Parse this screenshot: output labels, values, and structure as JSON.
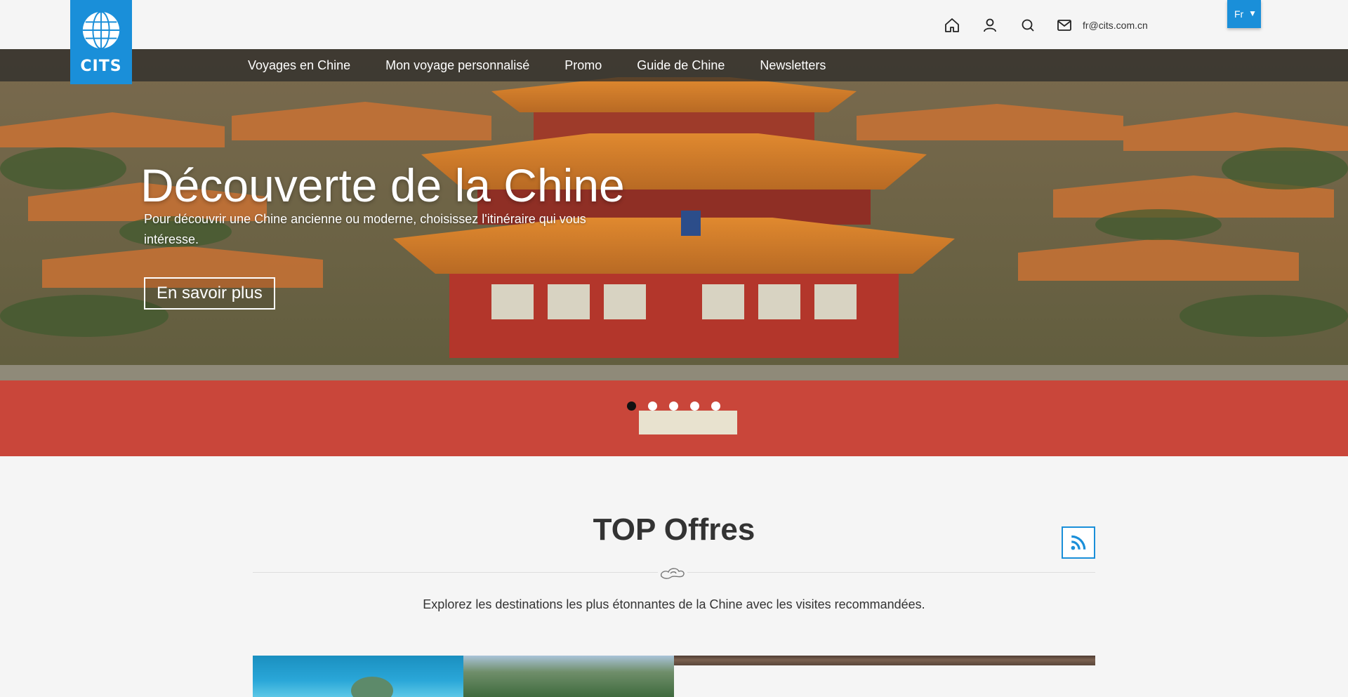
{
  "header": {
    "logo_text": "CITS",
    "email": "fr@cits.com.cn",
    "language": "Fr",
    "icons": [
      "home-icon",
      "user-icon",
      "search-icon",
      "mail-icon"
    ]
  },
  "nav": {
    "items": [
      {
        "label": "Voyages en Chine"
      },
      {
        "label": "Mon voyage personnalisé"
      },
      {
        "label": "Promo"
      },
      {
        "label": "Guide de Chine"
      },
      {
        "label": "Newsletters"
      }
    ]
  },
  "hero": {
    "title": "Découverte de la Chine",
    "subtitle": "Pour découvrir une Chine ancienne ou moderne, choisissez l'itinéraire qui vous intéresse.",
    "button_label": "En savoir plus",
    "slide_count": 5,
    "active_slide": 1
  },
  "top_offers": {
    "title": "TOP Offres",
    "description": "Explorez les destinations les plus étonnantes de la Chine avec les visites recommandées."
  },
  "colors": {
    "accent": "#1a8fd9",
    "nav_bg": "rgba(40,40,40,0.72)"
  }
}
